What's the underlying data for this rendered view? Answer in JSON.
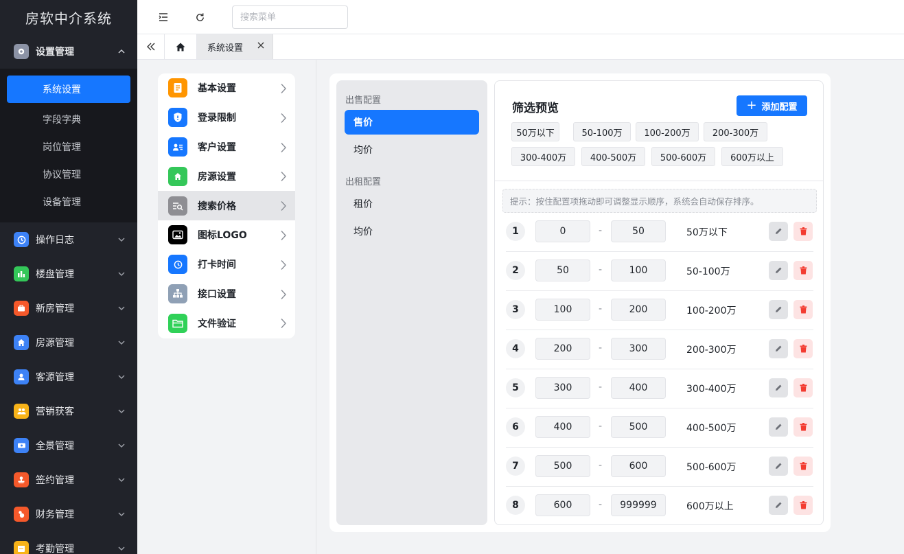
{
  "app": {
    "title": "房软中介系统"
  },
  "sidebar": {
    "expanded_group": {
      "label": "设置管理",
      "icon": "gear-icon",
      "color": "#8c93a6"
    },
    "sub_items": [
      {
        "label": "系统设置",
        "active": true
      },
      {
        "label": "字段字典"
      },
      {
        "label": "岗位管理"
      },
      {
        "label": "协议管理"
      },
      {
        "label": "设备管理"
      }
    ],
    "groups": [
      {
        "label": "操作日志",
        "icon": "clock-icon",
        "color": "#3d82f6"
      },
      {
        "label": "楼盘管理",
        "icon": "bar-chart-icon",
        "color": "#34c759"
      },
      {
        "label": "新房管理",
        "icon": "briefcase-icon",
        "color": "#f5592b"
      },
      {
        "label": "房源管理",
        "icon": "home-icon",
        "color": "#3d82f6"
      },
      {
        "label": "客源管理",
        "icon": "user-icon",
        "color": "#3d82f6"
      },
      {
        "label": "营销获客",
        "icon": "people-icon",
        "color": "#f8b319"
      },
      {
        "label": "全景管理",
        "icon": "panorama-icon",
        "color": "#3d82f6"
      },
      {
        "label": "签约管理",
        "icon": "stamp-icon",
        "color": "#f5592b"
      },
      {
        "label": "财务管理",
        "icon": "money-bag-icon",
        "color": "#f5592b"
      },
      {
        "label": "考勤管理",
        "icon": "calendar-icon",
        "color": "#f8b319"
      }
    ]
  },
  "topbar": {
    "search_placeholder": "搜索菜单"
  },
  "tabs": {
    "active_label": "系统设置"
  },
  "settings_menu": [
    {
      "label": "基本设置",
      "icon": "document-icon",
      "color": "#ff9500"
    },
    {
      "label": "登录限制",
      "icon": "shield-icon",
      "color": "#1677ff"
    },
    {
      "label": "客户设置",
      "icon": "contact-card-icon",
      "color": "#1677ff"
    },
    {
      "label": "房源设置",
      "icon": "home-icon",
      "color": "#34c759"
    },
    {
      "label": "搜索价格",
      "icon": "search-list-icon",
      "color": "#8e8e93",
      "active": true
    },
    {
      "label": "图标LOGO",
      "icon": "image-icon",
      "color": "#000000"
    },
    {
      "label": "打卡时间",
      "icon": "clock-icon",
      "color": "#1677ff"
    },
    {
      "label": "接口设置",
      "icon": "hierarchy-icon",
      "color": "#8fa0b5"
    },
    {
      "label": "文件验证",
      "icon": "folder-icon",
      "color": "#30d158"
    }
  ],
  "categories": {
    "sale_heading": "出售配置",
    "sale_items": [
      {
        "label": "售价",
        "active": true
      },
      {
        "label": "均价"
      }
    ],
    "rent_heading": "出租配置",
    "rent_items": [
      {
        "label": "租价"
      },
      {
        "label": "均价"
      }
    ]
  },
  "detail": {
    "title": "筛选预览",
    "add_button": "添加配置",
    "chips": [
      "50万以下",
      "50-100万",
      "100-200万",
      "200-300万",
      "300-400万",
      "400-500万",
      "500-600万",
      "600万以上"
    ],
    "hint": "提示：按住配置项拖动即可调整显示顺序，系统会自动保存排序。",
    "rows": [
      {
        "index": "1",
        "min": "0",
        "max": "50",
        "label": "50万以下"
      },
      {
        "index": "2",
        "min": "50",
        "max": "100",
        "label": "50-100万"
      },
      {
        "index": "3",
        "min": "100",
        "max": "200",
        "label": "100-200万"
      },
      {
        "index": "4",
        "min": "200",
        "max": "300",
        "label": "200-300万"
      },
      {
        "index": "5",
        "min": "300",
        "max": "400",
        "label": "300-400万"
      },
      {
        "index": "6",
        "min": "400",
        "max": "500",
        "label": "400-500万"
      },
      {
        "index": "7",
        "min": "500",
        "max": "600",
        "label": "500-600万"
      },
      {
        "index": "8",
        "min": "600",
        "max": "999999",
        "label": "600万以上"
      }
    ],
    "dash": "-"
  },
  "colors": {
    "accent": "#1677ff",
    "danger": "#ff3b30",
    "sidebar_bg": "#21232a"
  }
}
